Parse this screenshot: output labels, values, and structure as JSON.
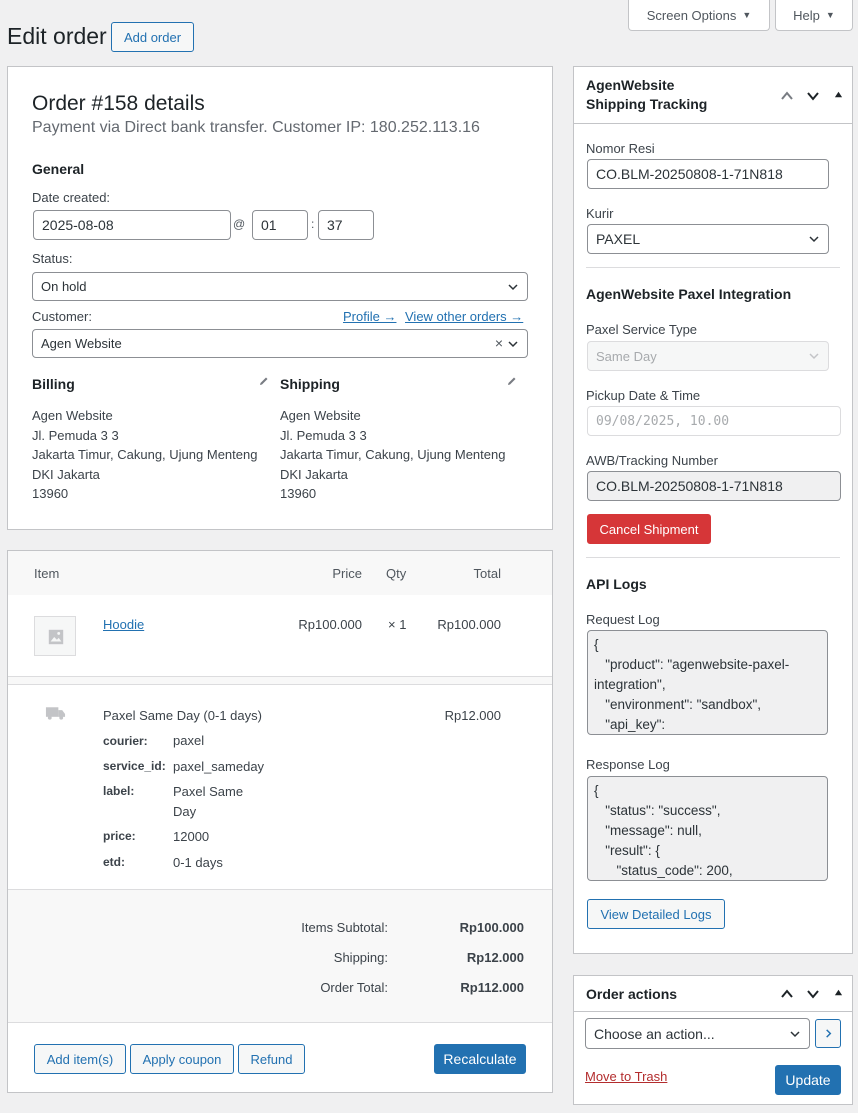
{
  "header": {
    "title": "Edit order",
    "add_order": "Add order",
    "screen_options": "Screen Options",
    "help": "Help"
  },
  "order": {
    "heading": "Order #158 details",
    "subheading": "Payment via Direct bank transfer. Customer IP: 180.252.113.16",
    "general_heading": "General",
    "date_label": "Date created:",
    "date_value": "2025-08-08",
    "at_sign": "@",
    "hour": "01",
    "colon": ":",
    "minute": "37",
    "status_label": "Status:",
    "status_value": "On hold",
    "customer_label": "Customer:",
    "profile_link": "Profile →",
    "view_orders_link": "View other orders →",
    "customer_value": "Agen Website",
    "customer_clear": "×"
  },
  "billing": {
    "heading": "Billing",
    "lines": [
      "Agen Website",
      "Jl. Pemuda 3 3",
      "Jakarta Timur, Cakung, Ujung Menteng",
      "DKI Jakarta",
      "13960"
    ]
  },
  "shipping_address": {
    "heading": "Shipping",
    "lines": [
      "Agen Website",
      "Jl. Pemuda 3 3",
      "Jakarta Timur, Cakung, Ujung Menteng",
      "DKI Jakarta",
      "13960"
    ]
  },
  "items": {
    "columns": {
      "item": "Item",
      "price": "Price",
      "qty": "Qty",
      "total": "Total"
    },
    "product": {
      "name": "Hoodie",
      "price": "Rp100.000",
      "qty": "× 1",
      "total": "Rp100.000"
    },
    "shipping_line": {
      "name": "Paxel Same Day (0-1 days)",
      "total": "Rp12.000",
      "meta": [
        {
          "key": "courier:",
          "value": "paxel"
        },
        {
          "key": "service_id:",
          "value": "paxel_sameday"
        },
        {
          "key": "label:",
          "value": "Paxel Same\nDay"
        },
        {
          "key": "price:",
          "value": "12000"
        },
        {
          "key": "etd:",
          "value": "0-1 days"
        }
      ]
    },
    "totals": {
      "subtotal_label": "Items Subtotal:",
      "subtotal_value": "Rp100.000",
      "shipping_label": "Shipping:",
      "shipping_value": "Rp12.000",
      "total_label": "Order Total:",
      "total_value": "Rp112.000"
    },
    "buttons": {
      "add_items": "Add item(s)",
      "apply_coupon": "Apply coupon",
      "refund": "Refund",
      "recalculate": "Recalculate"
    }
  },
  "tracking": {
    "title_line1": "AgenWebsite",
    "title_line2": "Shipping Tracking",
    "resi_label": "Nomor Resi",
    "resi_value": "CO.BLM-20250808-1-71N818",
    "kurir_label": "Kurir",
    "kurir_value": "PAXEL",
    "integration_heading": "AgenWebsite Paxel Integration",
    "service_type_label": "Paxel Service Type",
    "service_type_value": "Same Day",
    "pickup_label": "Pickup Date & Time",
    "pickup_value": "09/08/2025, 10.00",
    "awb_label": "AWB/Tracking Number",
    "awb_value": "CO.BLM-20250808-1-71N818",
    "cancel_button": "Cancel Shipment",
    "api_logs_heading": "API Logs",
    "request_label": "Request Log",
    "request_text": "{\n   \"product\": \"agenwebsite-paxel-\nintegration\",\n   \"environment\": \"sandbox\",\n   \"api_key\":",
    "response_label": "Response Log",
    "response_text": "{\n   \"status\": \"success\",\n   \"message\": null,\n   \"result\": {\n      \"status_code\": 200,",
    "detailed_logs_button": "View Detailed Logs"
  },
  "order_actions": {
    "title": "Order actions",
    "select_value": "Choose an action...",
    "trash_link": "Move to Trash",
    "update_button": "Update"
  },
  "colors": {
    "accent": "#2271b1",
    "danger": "#d63638",
    "border": "#c3c4c7",
    "background": "#f0f0f1"
  }
}
